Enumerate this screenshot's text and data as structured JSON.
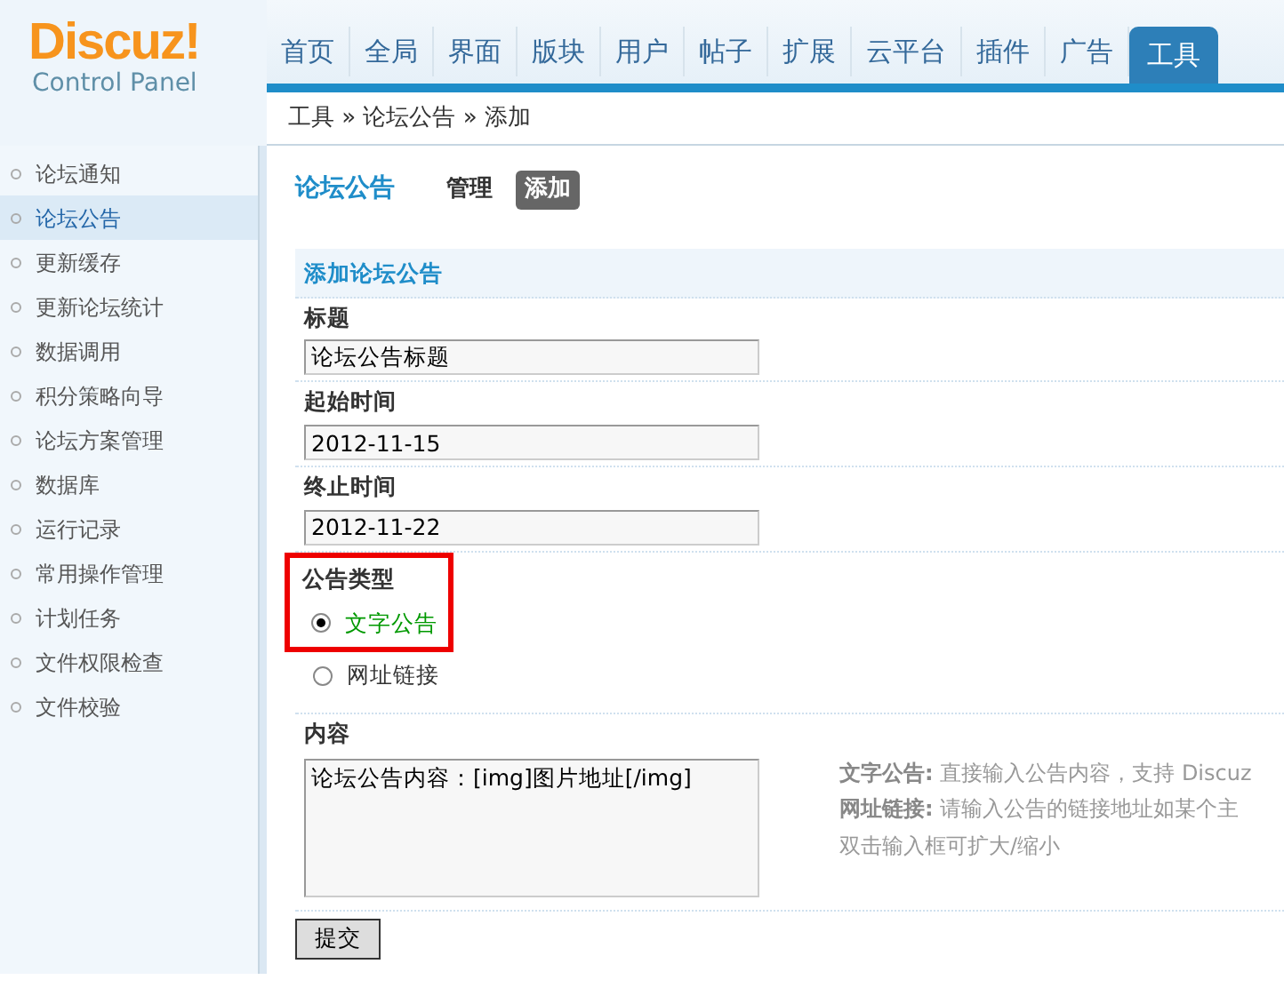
{
  "logo": {
    "title": "Discuz!",
    "subtitle": "Control Panel"
  },
  "nav": [
    {
      "label": "首页",
      "selected": false
    },
    {
      "label": "全局",
      "selected": false
    },
    {
      "label": "界面",
      "selected": false
    },
    {
      "label": "版块",
      "selected": false
    },
    {
      "label": "用户",
      "selected": false
    },
    {
      "label": "帖子",
      "selected": false
    },
    {
      "label": "扩展",
      "selected": false
    },
    {
      "label": "云平台",
      "selected": false
    },
    {
      "label": "插件",
      "selected": false
    },
    {
      "label": "广告",
      "selected": false
    },
    {
      "label": "工具",
      "selected": true
    }
  ],
  "breadcrumb": "工具 » 论坛公告 » 添加",
  "sidebar": {
    "items": [
      {
        "label": "论坛通知",
        "selected": false
      },
      {
        "label": "论坛公告",
        "selected": true
      },
      {
        "label": "更新缓存",
        "selected": false
      },
      {
        "label": "更新论坛统计",
        "selected": false
      },
      {
        "label": "数据调用",
        "selected": false
      },
      {
        "label": "积分策略向导",
        "selected": false
      },
      {
        "label": "论坛方案管理",
        "selected": false
      },
      {
        "label": "数据库",
        "selected": false
      },
      {
        "label": "运行记录",
        "selected": false
      },
      {
        "label": "常用操作管理",
        "selected": false
      },
      {
        "label": "计划任务",
        "selected": false
      },
      {
        "label": "文件权限检查",
        "selected": false
      },
      {
        "label": "文件校验",
        "selected": false
      }
    ]
  },
  "page": {
    "title": "论坛公告",
    "tabs": [
      {
        "label": "管理",
        "selected": false
      },
      {
        "label": "添加",
        "selected": true
      }
    ]
  },
  "form": {
    "heading": "添加论坛公告",
    "fields": [
      {
        "kind": "text",
        "label": "标题",
        "value": "论坛公告标题"
      },
      {
        "kind": "text",
        "label": "起始时间",
        "value": "2012-11-15"
      },
      {
        "kind": "text",
        "label": "终止时间",
        "value": "2012-11-22"
      },
      {
        "kind": "radio",
        "label": "公告类型",
        "highlighted": true,
        "options": [
          {
            "label": "文字公告",
            "selected": true
          },
          {
            "label": "网址链接",
            "selected": false
          }
        ]
      },
      {
        "kind": "textarea",
        "label": "内容",
        "value": "论坛公告内容：[img]图片地址[/img]",
        "hints": [
          "**文字公告:** 直接输入公告内容，支持 Discuz",
          "**网址链接:** 请输入公告的链接地址如某个主",
          "双击输入框可扩大/缩小"
        ]
      }
    ],
    "submit": "提交"
  }
}
